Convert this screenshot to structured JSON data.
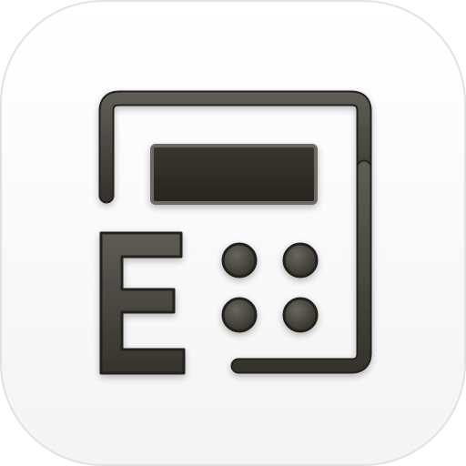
{
  "app_icon": {
    "icon": "calculator-e-icon",
    "letter": "E",
    "colors": {
      "background": "#ffffff",
      "tile_top": "#ffffff",
      "tile_bottom": "#f4f4f4",
      "tile_border": "#e2e2e2",
      "glyph_top": "#5e5b55",
      "glyph_bottom": "#36332d",
      "glyph_edge": "#24221e",
      "display_fill": "#2f2c27"
    }
  }
}
